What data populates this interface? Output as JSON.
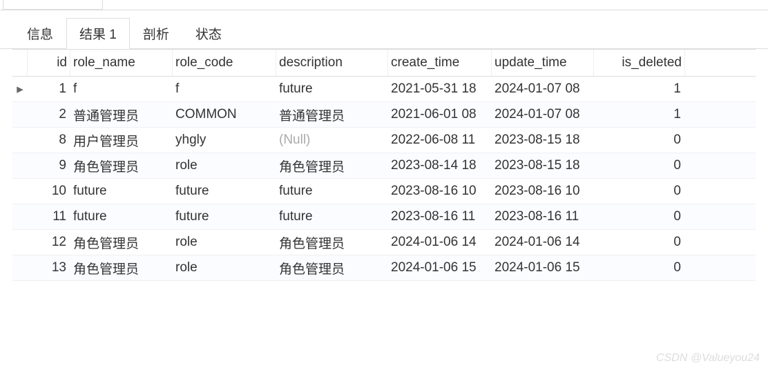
{
  "tabs": [
    {
      "label": "信息",
      "active": false
    },
    {
      "label": "结果 1",
      "active": true
    },
    {
      "label": "剖析",
      "active": false
    },
    {
      "label": "状态",
      "active": false
    }
  ],
  "table": {
    "columns": {
      "id": "id",
      "role_name": "role_name",
      "role_code": "role_code",
      "description": "description",
      "create_time": "create_time",
      "update_time": "update_time",
      "is_deleted": "is_deleted"
    },
    "null_label": "(Null)",
    "current_marker": "▸",
    "rows": [
      {
        "marker": "▸",
        "id": "1",
        "role_name": "f",
        "role_code": "f",
        "description": "future",
        "create_time": "2021-05-31 18",
        "update_time": "2024-01-07 08",
        "is_deleted": "1"
      },
      {
        "marker": "",
        "id": "2",
        "role_name": "普通管理员",
        "role_code": "COMMON",
        "description": "普通管理员",
        "create_time": "2021-06-01 08",
        "update_time": "2024-01-07 08",
        "is_deleted": "1"
      },
      {
        "marker": "",
        "id": "8",
        "role_name": "用户管理员",
        "role_code": "yhgly",
        "description": null,
        "create_time": "2022-06-08 11",
        "update_time": "2023-08-15 18",
        "is_deleted": "0"
      },
      {
        "marker": "",
        "id": "9",
        "role_name": "角色管理员",
        "role_code": "role",
        "description": "角色管理员",
        "create_time": "2023-08-14 18",
        "update_time": "2023-08-15 18",
        "is_deleted": "0"
      },
      {
        "marker": "",
        "id": "10",
        "role_name": "future",
        "role_code": "future",
        "description": "future",
        "create_time": "2023-08-16 10",
        "update_time": "2023-08-16 10",
        "is_deleted": "0"
      },
      {
        "marker": "",
        "id": "11",
        "role_name": "future",
        "role_code": "future",
        "description": "future",
        "create_time": "2023-08-16 11",
        "update_time": "2023-08-16 11",
        "is_deleted": "0"
      },
      {
        "marker": "",
        "id": "12",
        "role_name": "角色管理员",
        "role_code": "role",
        "description": "角色管理员",
        "create_time": "2024-01-06 14",
        "update_time": "2024-01-06 14",
        "is_deleted": "0"
      },
      {
        "marker": "",
        "id": "13",
        "role_name": "角色管理员",
        "role_code": "role",
        "description": "角色管理员",
        "create_time": "2024-01-06 15",
        "update_time": "2024-01-06 15",
        "is_deleted": "0"
      }
    ]
  },
  "watermark": "CSDN @Valueyou24"
}
